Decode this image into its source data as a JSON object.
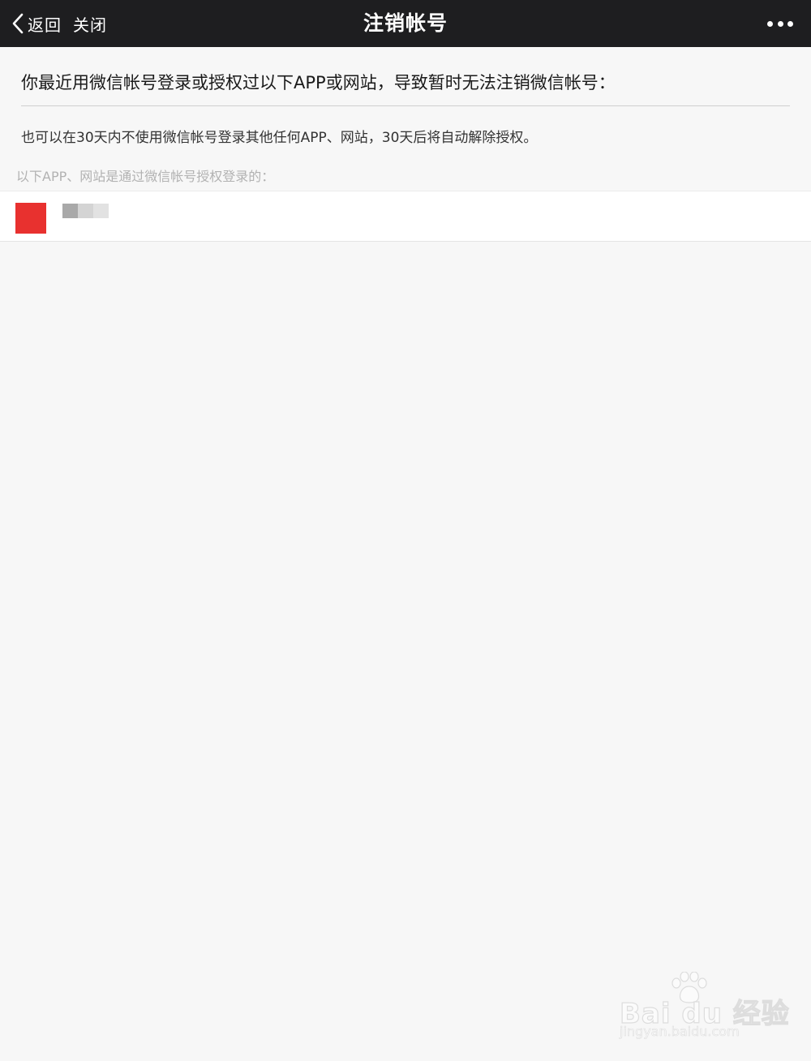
{
  "navbar": {
    "back_label": "返回",
    "close_label": "关闭",
    "title": "注销帐号",
    "more_icon": "ellipsis-icon"
  },
  "main": {
    "heading": "你最近用微信帐号登录或授权过以下APP或网站，导致暂时无法注销微信帐号：",
    "note": "也可以在30天内不使用微信帐号登录其他任何APP、网站，30天后将自动解除授权。",
    "list_label": "以下APP、网站是通过微信帐号授权登录的：",
    "apps": [
      {
        "icon_color": "#e8312f",
        "name": ""
      }
    ]
  },
  "watermark": {
    "brand": "Bai du 经验",
    "url": "jingyan.baidu.com"
  },
  "colors": {
    "navbar_bg": "#1e1e20",
    "page_bg": "#f7f7f7",
    "app_icon": "#e8312f"
  }
}
